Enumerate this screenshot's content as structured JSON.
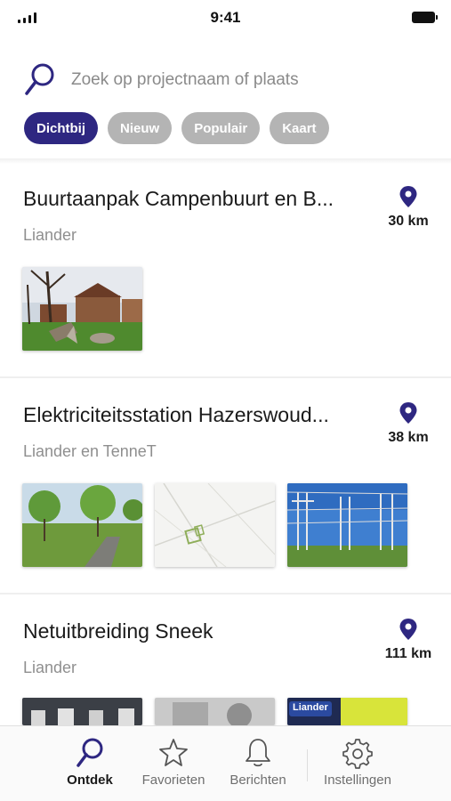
{
  "status_bar": {
    "time": "9:41"
  },
  "search": {
    "placeholder": "Zoek op projectnaam of plaats"
  },
  "filters": [
    {
      "label": "Dichtbij",
      "active": true
    },
    {
      "label": "Nieuw",
      "active": false
    },
    {
      "label": "Populair",
      "active": false
    },
    {
      "label": "Kaart",
      "active": false
    }
  ],
  "projects": [
    {
      "title": "Buurtaanpak Campenbuurt en B...",
      "owner": "Liander",
      "distance": "30 km"
    },
    {
      "title": "Elektriciteitsstation Hazerswoud...",
      "owner": "Liander en TenneT",
      "distance": "38 km"
    },
    {
      "title": "Netuitbreiding Sneek",
      "owner": "Liander",
      "distance": "111 km",
      "badge": "Liander"
    }
  ],
  "tabs": [
    {
      "label": "Ontdek",
      "icon": "search-icon",
      "active": true
    },
    {
      "label": "Favorieten",
      "icon": "star-icon",
      "active": false
    },
    {
      "label": "Berichten",
      "icon": "bell-icon",
      "active": false
    },
    {
      "label": "Instellingen",
      "icon": "gear-icon",
      "active": false
    }
  ],
  "colors": {
    "accent": "#2e2781",
    "chip_inactive": "#b4b4b4",
    "muted_text": "#8f8f8f"
  }
}
